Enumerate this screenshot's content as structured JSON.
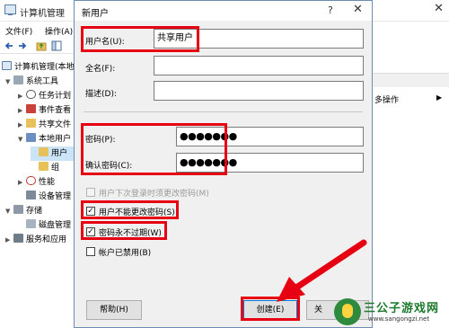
{
  "background": {
    "title": "计算机管理",
    "menu": [
      "文件(F)",
      "操作(A)"
    ],
    "tree": [
      {
        "label": "计算机管理(本地",
        "arrow": "",
        "depth": 0
      },
      {
        "label": "系统工具",
        "arrow": "▼",
        "depth": 1
      },
      {
        "label": "任务计划",
        "arrow": "▶",
        "depth": 2
      },
      {
        "label": "事件查看",
        "arrow": "▶",
        "depth": 2
      },
      {
        "label": "共享文件",
        "arrow": "▶",
        "depth": 2
      },
      {
        "label": "本地用户",
        "arrow": "▼",
        "depth": 2
      },
      {
        "label": "用户",
        "arrow": "",
        "depth": 3,
        "selected": true
      },
      {
        "label": "组",
        "arrow": "",
        "depth": 3
      },
      {
        "label": "性能",
        "arrow": "▶",
        "depth": 2
      },
      {
        "label": "设备管理",
        "arrow": "",
        "depth": 2
      },
      {
        "label": "存储",
        "arrow": "▼",
        "depth": 1
      },
      {
        "label": "磁盘管理",
        "arrow": "",
        "depth": 2
      },
      {
        "label": "服务和应用",
        "arrow": "▶",
        "depth": 1
      }
    ],
    "actions": {
      "more_label": "多操作",
      "arrow": "▶"
    }
  },
  "dialog": {
    "title": "新用户",
    "help_icon": "?",
    "close_icon": "✕",
    "username": {
      "label": "用户名(U):",
      "value": "共享用户"
    },
    "fullname": {
      "label": "全名(F):",
      "value": ""
    },
    "description": {
      "label": "描述(D):",
      "value": ""
    },
    "password": {
      "label": "密码(P):",
      "value": "●●●●●●●"
    },
    "confirm": {
      "label": "确认密码(C):",
      "value": "●●●●●●●"
    },
    "checkboxes": [
      {
        "label": "用户下次登录时须更改密码(M)",
        "checked": false,
        "disabled": true
      },
      {
        "label": "用户不能更改密码(S)",
        "checked": true,
        "disabled": false
      },
      {
        "label": "密码永不过期(W)",
        "checked": true,
        "disabled": false
      },
      {
        "label": "帐户已禁用(B)",
        "checked": false,
        "disabled": false
      }
    ],
    "buttons": {
      "help": "帮助(H)",
      "create": "创建(E)",
      "close": "关"
    }
  },
  "watermark": {
    "name": "三公子游戏网",
    "url": "www.sangongzi.net"
  },
  "colors": {
    "highlight": "#e60012",
    "selection": "#cce4f7",
    "dialog_bg": "#f0f0f0"
  }
}
